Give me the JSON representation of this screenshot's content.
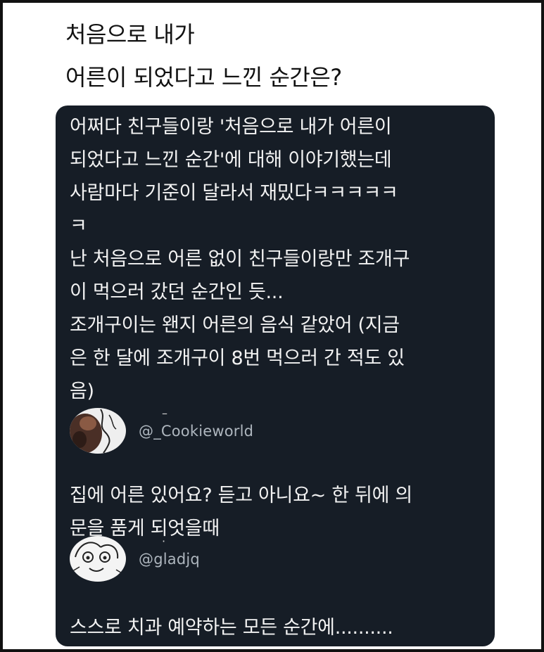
{
  "title": {
    "line1": "처음으로 내가",
    "line2": "어른이 되었다고 느낀 순간은?"
  },
  "tweets": [
    {
      "text": "어쩌다 친구들이랑 '처음으로 내가 어른이\n되었다고 느낀 순간'에 대해 이야기했는데\n사람마다 기준이 달라서 재밌다ㅋㅋㅋㅋㅋ\nㅋ\n난 처음으로 어른 없이 친구들이랑만 조개구\n이 먹으러 갔던 순간인 듯...\n조개구이는 왠지 어른의 음식 같았어 (지금\n은 한 달에 조개구이 8번 먹으러 간 적도 있\n음)"
    },
    {
      "author_name": "–",
      "handle": "@_Cookieworld",
      "text": "집에 어른 있어요? 듣고 아니요~ 한 뒤에 의\n문을 품게 되엇을때"
    },
    {
      "author_name": "·",
      "handle": "@gladjq",
      "text": "스스로 치과 예약하는 모든 순간에.........."
    }
  ],
  "colors": {
    "page_background": "#ffffff",
    "card_background": "#161d26",
    "tweet_text": "#f2f2f2",
    "handle_text": "#aeb6be"
  },
  "icons": {
    "avatar1": "profile-photo-avatar",
    "avatar2": "cartoon-character-avatar"
  }
}
